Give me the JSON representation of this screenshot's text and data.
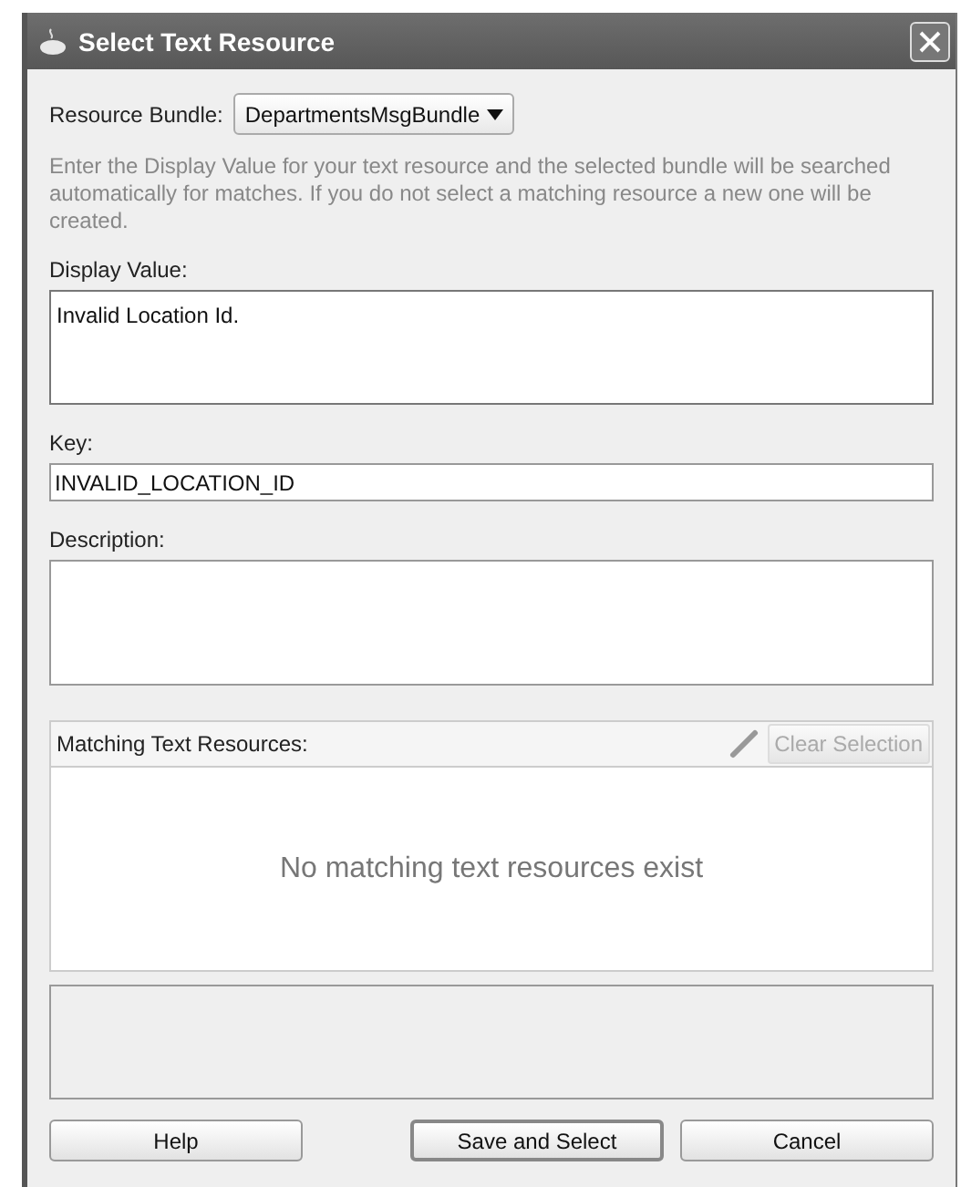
{
  "window": {
    "title": "Select Text Resource"
  },
  "resource_bundle": {
    "label": "Resource Bundle:",
    "value": "DepartmentsMsgBundle"
  },
  "instructions": "Enter the Display Value for your text resource and the selected bundle will be searched automatically for matches.  If you do not select a matching resource a new one will be created.",
  "fields": [
    {
      "label": "Display Value:",
      "value": "Invalid Location Id.",
      "kind": "multiline",
      "focused": true
    },
    {
      "label": "Key:",
      "value": "INVALID_LOCATION_ID",
      "kind": "single",
      "focused": false
    },
    {
      "label": "Description:",
      "kind": "multiline",
      "focused": false
    }
  ],
  "matching": {
    "label": "Matching Text Resources:",
    "clear_button": {
      "label": "Clear Selection",
      "disabled": true
    },
    "empty_message": "No matching text resources exist"
  },
  "buttons": [
    {
      "label": "Help",
      "default": false
    },
    {
      "label": "Save and Select",
      "default": true
    },
    {
      "label": "Cancel",
      "default": false
    }
  ]
}
